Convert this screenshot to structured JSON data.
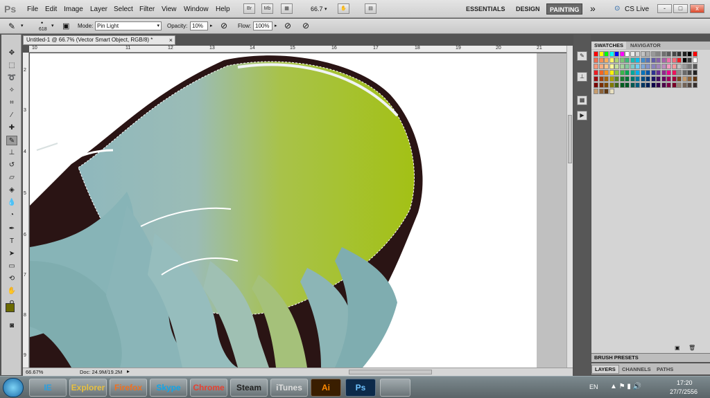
{
  "app": {
    "logo": "Ps"
  },
  "menu": [
    "File",
    "Edit",
    "Image",
    "Layer",
    "Select",
    "Filter",
    "View",
    "Window",
    "Help"
  ],
  "menubar_buttons": {
    "br": "Br",
    "mb": "Mb",
    "zoom": "66.7"
  },
  "workspaces": [
    "ESSENTIALS",
    "DESIGN",
    "PAINTING"
  ],
  "workspace_active": "PAINTING",
  "workspace_more": "»",
  "cs_live": "CS Live",
  "window_controls": {
    "minimize": "-",
    "restore": "□",
    "close": "x"
  },
  "options": {
    "brush_size": "618",
    "mode_label": "Mode:",
    "mode_value": "Pin Light",
    "opacity_label": "Opacity:",
    "opacity_value": "10%",
    "flow_label": "Flow:",
    "flow_value": "100%"
  },
  "document": {
    "tab_title": "Untitled-1 @ 66.7% (Vector Smart Object, RGB/8) *",
    "tab_close": "×",
    "zoom": "66.67%",
    "doc_size": "Doc: 24.9M/19.2M"
  },
  "ruler_top": [
    "10",
    "11",
    "12",
    "13",
    "14",
    "15",
    "16",
    "17",
    "18",
    "19",
    "20",
    "21"
  ],
  "ruler_left": [
    "2",
    "3",
    "4",
    "5",
    "6",
    "7",
    "8",
    "9"
  ],
  "panels": {
    "swatches_tab": "SWATCHES",
    "navigator_tab": "NAVIGATOR",
    "brush_presets": "BRUSH PRESETS",
    "layers_tab": "LAYERS",
    "channels_tab": "CHANNELS",
    "paths_tab": "PATHS"
  },
  "swatch_rows": [
    [
      "#ff0000",
      "#ffff00",
      "#00ff00",
      "#00ffff",
      "#0000ff",
      "#ff00ff",
      "#ffffff",
      "#ebebeb",
      "#d6d6d6",
      "#c2c2c2",
      "#adadad",
      "#999999",
      "#858585",
      "#707070",
      "#5c5c5c",
      "#474747",
      "#333333",
      "#1f1f1f",
      "#000000",
      "#ff0000"
    ],
    [
      "#f26c4f",
      "#f68e55",
      "#fbaf5c",
      "#fff467",
      "#acd372",
      "#7cc576",
      "#3bb878",
      "#1abbb4",
      "#00bff3",
      "#438ccb",
      "#5574b9",
      "#605ca8",
      "#855fa8",
      "#a763a9",
      "#f06ea9",
      "#f26d7d",
      "#ee1d24",
      "#000000",
      "#3a3a3a",
      "#ffffff"
    ],
    [
      "#f7977a",
      "#f9ad81",
      "#fdc68c",
      "#fff79a",
      "#c4df9b",
      "#a3d39c",
      "#82ca9d",
      "#7bcdc8",
      "#6ecff6",
      "#7ea7d8",
      "#8493ca",
      "#8882be",
      "#a286bd",
      "#bc8cbf",
      "#f49bc1",
      "#f5989d",
      "#c4c4c4",
      "#9d9d9d",
      "#797979",
      "#555555"
    ],
    [
      "#ed1c24",
      "#f26522",
      "#f7941d",
      "#fff200",
      "#8dc63f",
      "#39b54a",
      "#00a651",
      "#00a99d",
      "#00aeef",
      "#0072bc",
      "#0054a6",
      "#2e3192",
      "#662d91",
      "#92278f",
      "#ec008c",
      "#ed145b",
      "#8e8e8e",
      "#6a6a6a",
      "#464646",
      "#222222"
    ],
    [
      "#9e0b0f",
      "#a0410d",
      "#a36209",
      "#aba000",
      "#598527",
      "#1a7b30",
      "#007236",
      "#00746b",
      "#0076a3",
      "#004b80",
      "#003471",
      "#1b1464",
      "#440e62",
      "#630460",
      "#9e005d",
      "#9e0039",
      "#7a4a20",
      "#c69c6d",
      "#8c6239",
      "#603913"
    ],
    [
      "#790000",
      "#7b2e00",
      "#7d4900",
      "#827b00",
      "#406618",
      "#005e20",
      "#005826",
      "#005952",
      "#005b7f",
      "#003663",
      "#002157",
      "#0d004c",
      "#32004b",
      "#4b0049",
      "#7b0046",
      "#7a0026",
      "#998675",
      "#736357",
      "#534741",
      "#362f2d"
    ],
    [
      "#c69c6d",
      "#8c6239",
      "#603913",
      "#e8e0c0"
    ]
  ],
  "taskbar": [
    "IE",
    "Explorer",
    "Firefox",
    "Skype",
    "Chrome",
    "Steam",
    "iTunes",
    "Ai",
    "Ps",
    ""
  ],
  "clock": {
    "lang": "EN",
    "time": "17:20",
    "date": "27/7/2556"
  }
}
